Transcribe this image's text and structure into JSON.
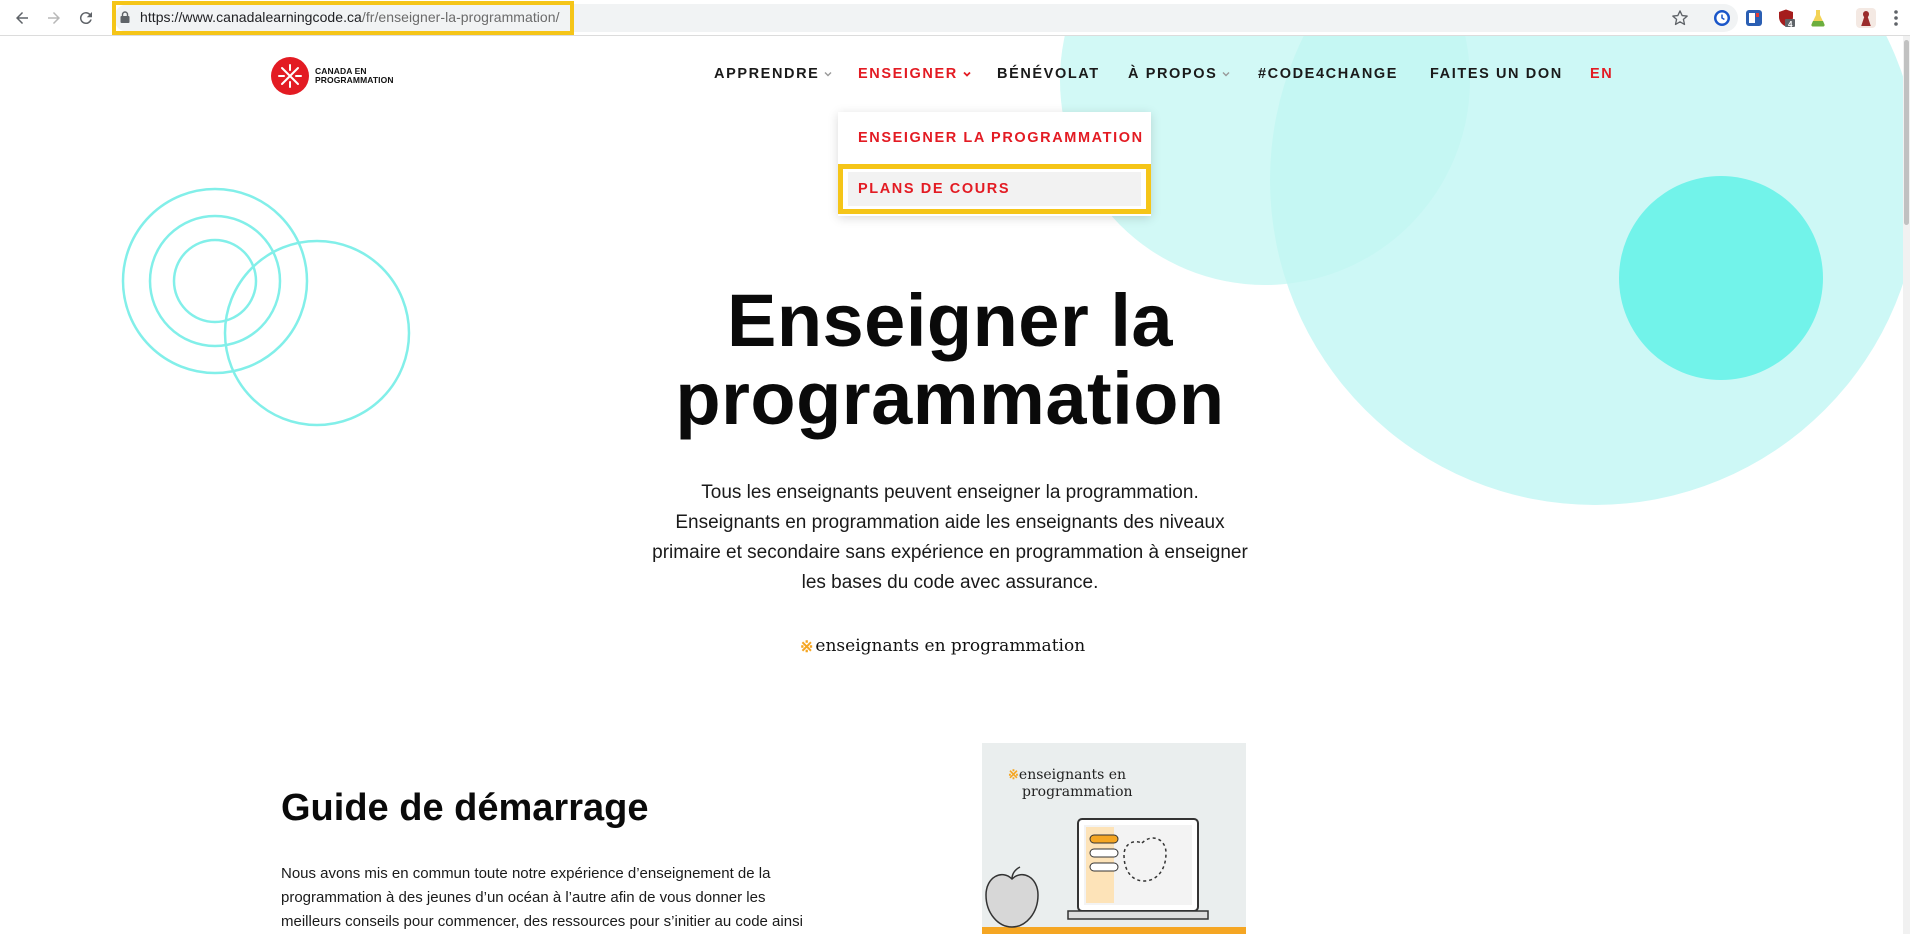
{
  "browser": {
    "url_host": "https://www.canadalearningcode.ca",
    "url_path": "/fr/enseigner-la-programmation/",
    "extensions": [
      "clock-ext-icon",
      "bookmark-ext-icon",
      "shield-ext-icon",
      "flask-ext-icon",
      "profile-avatar"
    ],
    "extension_badge": "4",
    "colors": {
      "highlight": "#f5c518",
      "omnibox": "#f1f3f4"
    }
  },
  "site": {
    "logo_line1": "CANADA EN",
    "logo_line2": "PROGRAMMATION",
    "nav": {
      "apprendre": "APPRENDRE",
      "enseigner": "ENSEIGNER",
      "benevolat": "BÉNÉVOLAT",
      "a_propos": "À PROPOS",
      "code4change": "#CODE4CHANGE",
      "don": "FAITES UN DON",
      "lang": "EN"
    },
    "dropdown": {
      "item1": "ENSEIGNER LA PROGRAMMATION",
      "item2": "PLANS DE COURS"
    },
    "colors": {
      "brand_red": "#e31b23",
      "accent_yellow": "#f5a623",
      "teal": "#72f3ea"
    }
  },
  "hero": {
    "title_line1": "Enseigner la",
    "title_line2": "programmation",
    "desc_line1": "Tous les enseignants peuvent enseigner la programmation.",
    "desc_line2": "Enseignants en programmation aide les enseignants des niveaux",
    "desc_line3": "primaire et secondaire sans expérience en programmation à enseigner",
    "desc_line4": "les bases du code avec assurance.",
    "brand_asterisk": "※",
    "brand_text": "enseignants en programmation"
  },
  "guide": {
    "title": "Guide de démarrage",
    "text_line1": "Nous avons mis en commun toute notre expérience d’enseignement de la",
    "text_line2": "programmation à des jeunes d’un océan à l’autre afin de vous donner les",
    "text_line3": "meilleurs conseils pour commencer, des ressources pour s’initier au code ainsi",
    "card_asterisk": "※",
    "card_line1": "enseignants en",
    "card_line2": "programmation"
  }
}
